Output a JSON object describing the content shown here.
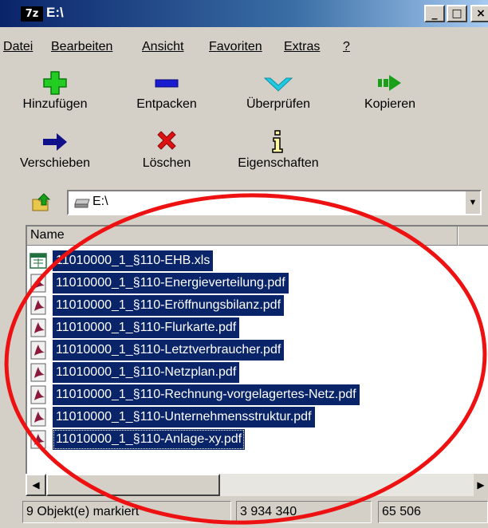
{
  "window": {
    "app_icon_text": "7z",
    "title": "E:\\",
    "minimize_glyph": "_",
    "maximize_glyph": "□",
    "close_glyph": "×"
  },
  "menu": [
    {
      "underline": "D",
      "rest": "atei"
    },
    {
      "underline": "B",
      "rest": "earbeiten"
    },
    {
      "underline": "A",
      "rest": "nsicht"
    },
    {
      "underline": "F",
      "rest": "avoriten"
    },
    {
      "underline": "E",
      "rest": "xtras"
    },
    {
      "underline": "?",
      "rest": ""
    }
  ],
  "toolbar": {
    "add": {
      "label": "Hinzufügen",
      "icon": "plus-icon",
      "color": "#22cc22"
    },
    "extract": {
      "label": "Entpacken",
      "icon": "minus-icon",
      "color": "#1a1ad0"
    },
    "test": {
      "label": "Überprüfen",
      "icon": "check-icon",
      "color": "#20c8e0"
    },
    "copy": {
      "label": "Kopieren",
      "icon": "copy-arrow-icon",
      "color": "#18a018"
    },
    "move": {
      "label": "Verschieben",
      "icon": "arrow-right-icon",
      "color": "#10108a"
    },
    "delete": {
      "label": "Löschen",
      "icon": "delete-x-icon",
      "color": "#dd1111"
    },
    "properties": {
      "label": "Eigenschaften",
      "icon": "info-icon",
      "color": "#000000"
    }
  },
  "address": {
    "value": "E:\\",
    "icon": "drive-icon"
  },
  "list": {
    "column_name": "Name",
    "files": [
      {
        "name": "11010000_1_§110-EHB.xls",
        "type": "xls"
      },
      {
        "name": "11010000_1_§110-Energieverteilung.pdf",
        "type": "pdf"
      },
      {
        "name": "11010000_1_§110-Eröffnungsbilanz.pdf",
        "type": "pdf"
      },
      {
        "name": "11010000_1_§110-Flurkarte.pdf",
        "type": "pdf"
      },
      {
        "name": "11010000_1_§110-Letztverbraucher.pdf",
        "type": "pdf"
      },
      {
        "name": "11010000_1_§110-Netzplan.pdf",
        "type": "pdf"
      },
      {
        "name": "11010000_1_§110-Rechnung-vorgelagertes-Netz.pdf",
        "type": "pdf"
      },
      {
        "name": "11010000_1_§110-Unternehmensstruktur.pdf",
        "type": "pdf"
      },
      {
        "name": "11010000_1_§110-Anlage-xy.pdf",
        "type": "pdf"
      }
    ],
    "selection_color": "#0a246a"
  },
  "status": {
    "selected": "9 Objekt(e) markiert",
    "size": "3 934 340",
    "packed": "65 506"
  },
  "annotation": {
    "color": "#ee1111",
    "shape": "ellipse"
  }
}
